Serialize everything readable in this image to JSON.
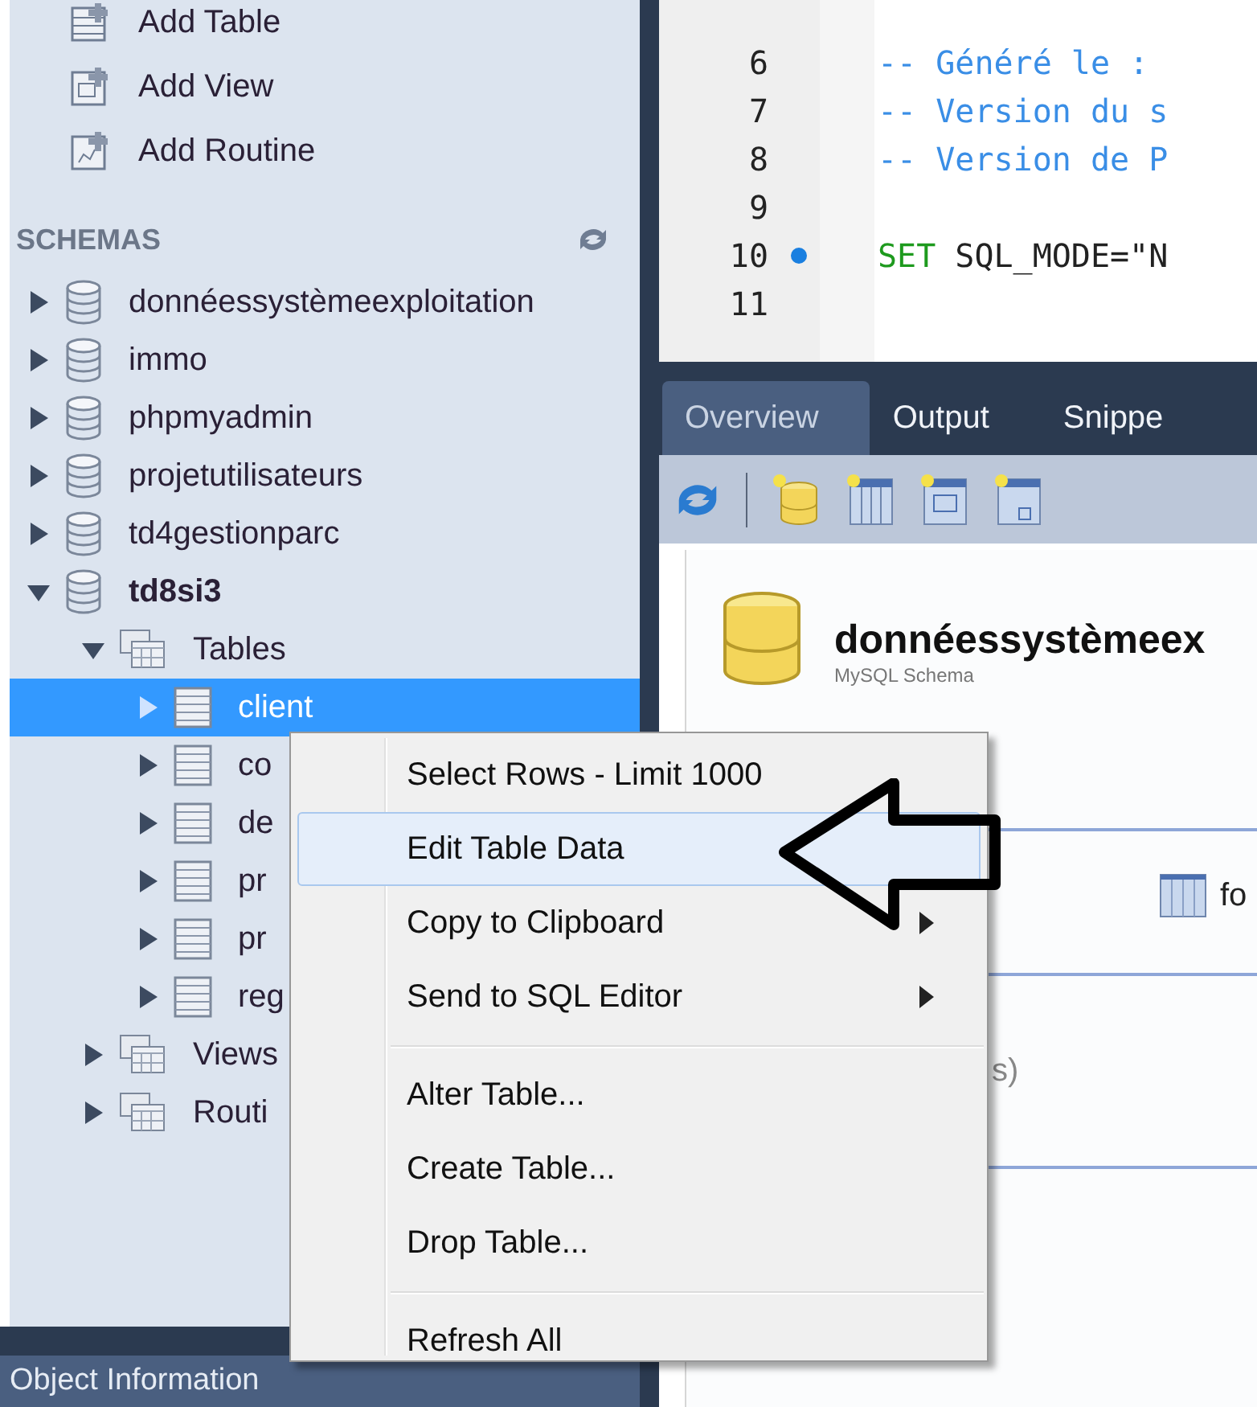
{
  "sidebar": {
    "actions": [
      {
        "label": "Add Table",
        "kind": "table"
      },
      {
        "label": "Add View",
        "kind": "view"
      },
      {
        "label": "Add Routine",
        "kind": "routine"
      }
    ],
    "schemas_header": "SCHEMAS",
    "schemas": [
      {
        "label": "donnéessystèmeexploitation",
        "kind": "schema",
        "expanded": false,
        "selected": false,
        "default": false
      },
      {
        "label": "immo",
        "kind": "schema",
        "expanded": false,
        "selected": false,
        "default": false
      },
      {
        "label": "phpmyadmin",
        "kind": "schema",
        "expanded": false,
        "selected": false,
        "default": false
      },
      {
        "label": "projetutilisateurs",
        "kind": "schema",
        "expanded": false,
        "selected": false,
        "default": false
      },
      {
        "label": "td4gestionparc",
        "kind": "schema",
        "expanded": false,
        "selected": false,
        "default": false
      },
      {
        "label": "td8si3",
        "kind": "schema",
        "expanded": true,
        "selected": false,
        "default": true,
        "children": [
          {
            "label": "Tables",
            "kind": "folder",
            "expanded": true,
            "selected": false,
            "children": [
              {
                "label": "client",
                "kind": "table",
                "expanded": false,
                "selected": true
              },
              {
                "label": "co",
                "kind": "table",
                "expanded": false,
                "selected": false
              },
              {
                "label": "de",
                "kind": "table",
                "expanded": false,
                "selected": false
              },
              {
                "label": "pr",
                "kind": "table",
                "expanded": false,
                "selected": false
              },
              {
                "label": "pr",
                "kind": "table",
                "expanded": false,
                "selected": false
              },
              {
                "label": "reg",
                "kind": "table",
                "expanded": false,
                "selected": false
              }
            ]
          },
          {
            "label": "Views",
            "kind": "folder",
            "expanded": false,
            "selected": false
          },
          {
            "label": "Routi",
            "kind": "folder",
            "expanded": false,
            "selected": false
          }
        ]
      }
    ],
    "bottom_panel": {
      "title": "Object Information"
    }
  },
  "editor": {
    "lines": [
      {
        "number": "6",
        "marker": false,
        "tokens": [
          {
            "text": "-- Généré le :",
            "kind": "comment"
          }
        ]
      },
      {
        "number": "7",
        "marker": false,
        "tokens": [
          {
            "text": "-- Version du s",
            "kind": "comment"
          }
        ]
      },
      {
        "number": "8",
        "marker": false,
        "tokens": [
          {
            "text": "-- Version de P",
            "kind": "comment"
          }
        ]
      },
      {
        "number": "9",
        "marker": false
      },
      {
        "number": "10",
        "marker": true,
        "tokens": [
          {
            "text": "SET",
            "kind": "keyword"
          },
          {
            "text": " SQL_MODE=\"N",
            "kind": "plain"
          }
        ]
      },
      {
        "number": "11",
        "marker": false
      }
    ]
  },
  "tabs": [
    {
      "label": "Overview",
      "selected": true
    },
    {
      "label": "Output",
      "selected": false
    },
    {
      "label": "Snippe",
      "selected": false
    }
  ],
  "overview": {
    "schema_name": "donnéessystèmeex",
    "schema_type": "MySQL Schema",
    "item_label": "fo",
    "partial_text": "s)"
  },
  "context_menu": {
    "items": [
      {
        "kind": "item",
        "label": "Select Rows - Limit 1000",
        "submenu": false,
        "highlighted": false
      },
      {
        "kind": "item",
        "label": "Edit Table Data",
        "submenu": false,
        "highlighted": true
      },
      {
        "kind": "item",
        "label": "Copy to Clipboard",
        "submenu": true,
        "highlighted": false
      },
      {
        "kind": "item",
        "label": "Send to SQL Editor",
        "submenu": true,
        "highlighted": false
      },
      {
        "kind": "separator"
      },
      {
        "kind": "item",
        "label": "Alter Table...",
        "submenu": false,
        "highlighted": false
      },
      {
        "kind": "item",
        "label": "Create Table...",
        "submenu": false,
        "highlighted": false
      },
      {
        "kind": "item",
        "label": "Drop Table...",
        "submenu": false,
        "highlighted": false
      },
      {
        "kind": "separator"
      },
      {
        "kind": "item",
        "label": "Refresh All",
        "submenu": false,
        "highlighted": false
      }
    ]
  }
}
